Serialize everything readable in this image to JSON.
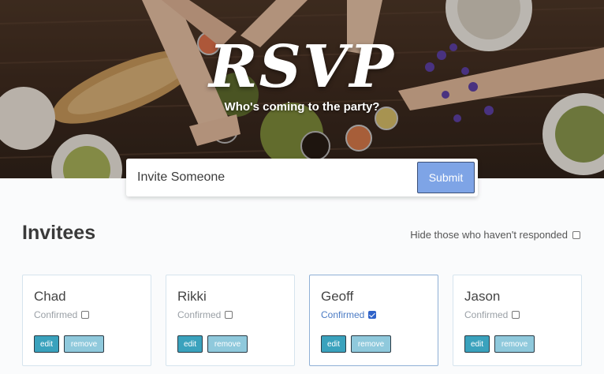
{
  "hero": {
    "title": "RSVP",
    "subtitle": "Who's coming to the party?"
  },
  "invite_form": {
    "input_placeholder": "Invite Someone",
    "input_value": "",
    "submit_label": "Submit"
  },
  "invitees_section": {
    "title": "Invitees",
    "filter_label": "Hide those who haven't responded",
    "filter_checked": false
  },
  "invitees": [
    {
      "name": "Chad",
      "confirmed_label": "Confirmed",
      "confirmed": false,
      "edit_label": "edit",
      "remove_label": "remove"
    },
    {
      "name": "Rikki",
      "confirmed_label": "Confirmed",
      "confirmed": false,
      "edit_label": "edit",
      "remove_label": "remove"
    },
    {
      "name": "Geoff",
      "confirmed_label": "Confirmed",
      "confirmed": true,
      "edit_label": "edit",
      "remove_label": "remove"
    },
    {
      "name": "Jason",
      "confirmed_label": "Confirmed",
      "confirmed": false,
      "edit_label": "edit",
      "remove_label": "remove"
    }
  ],
  "colors": {
    "submit_bg": "#7ea4e6",
    "edit_bg": "#3aa2bd",
    "remove_bg": "#8fc9dc",
    "confirmed_text": "#4b7bc4"
  }
}
